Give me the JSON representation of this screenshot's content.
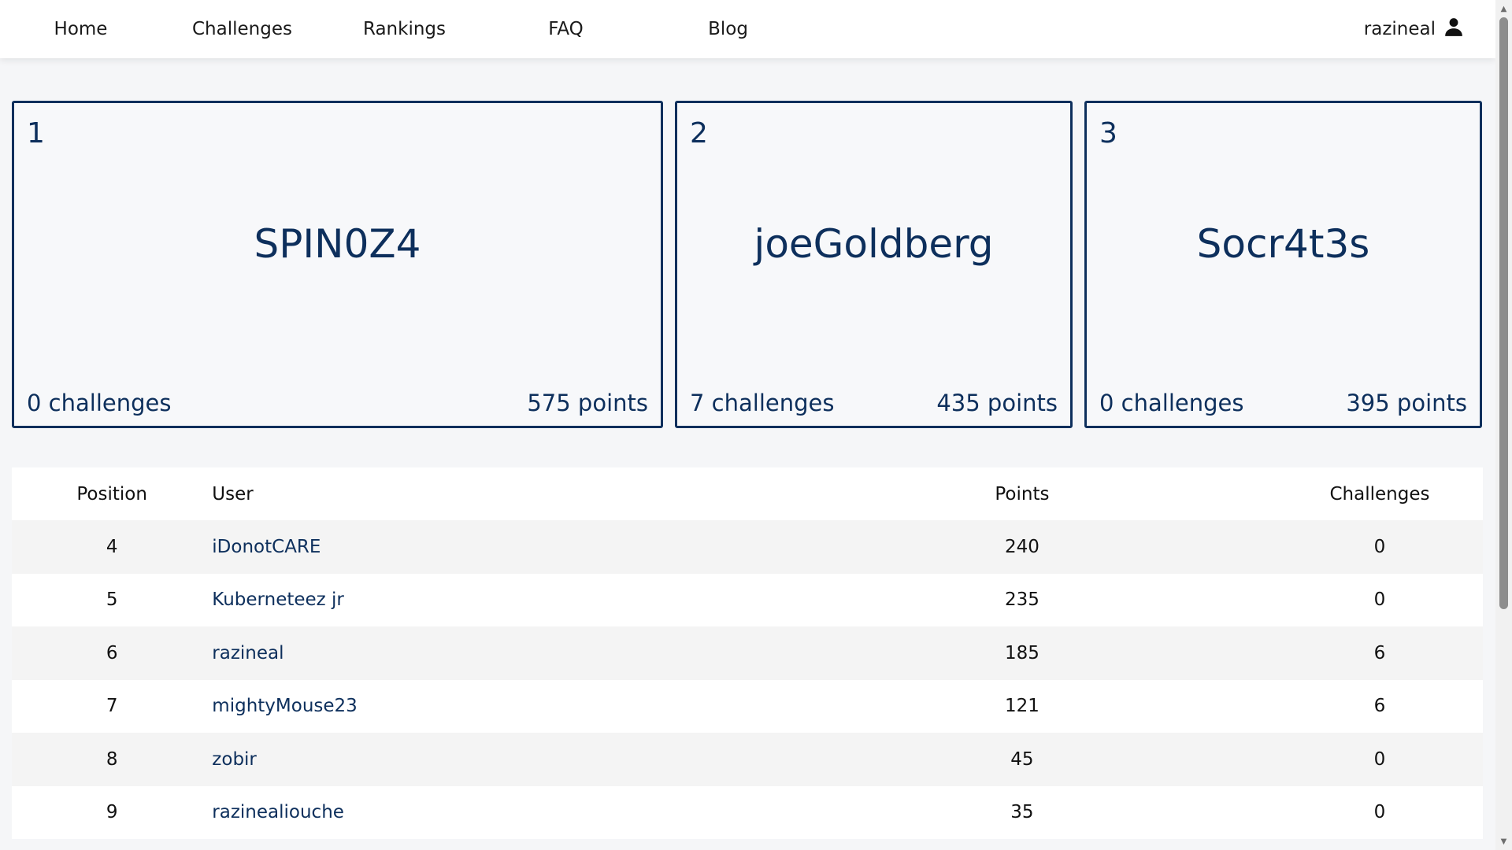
{
  "nav": {
    "items": [
      {
        "label": "Home"
      },
      {
        "label": "Challenges"
      },
      {
        "label": "Rankings"
      },
      {
        "label": "FAQ"
      },
      {
        "label": "Blog"
      }
    ],
    "username": "razineal",
    "user_icon": "user-icon"
  },
  "podium": [
    {
      "rank": "1",
      "name": "SPIN0Z4",
      "challenges": "0 challenges",
      "points": "575 points"
    },
    {
      "rank": "2",
      "name": "joeGoldberg",
      "challenges": "7 challenges",
      "points": "435 points"
    },
    {
      "rank": "3",
      "name": "Socr4t3s",
      "challenges": "0 challenges",
      "points": "395 points"
    }
  ],
  "table": {
    "headers": {
      "position": "Position",
      "user": "User",
      "points": "Points",
      "challenges": "Challenges"
    },
    "rows": [
      {
        "position": "4",
        "user": "iDonotCARE",
        "points": "240",
        "challenges": "0"
      },
      {
        "position": "5",
        "user": "Kuberneteez jr",
        "points": "235",
        "challenges": "0"
      },
      {
        "position": "6",
        "user": "razineal",
        "points": "185",
        "challenges": "6"
      },
      {
        "position": "7",
        "user": "mightyMouse23",
        "points": "121",
        "challenges": "6"
      },
      {
        "position": "8",
        "user": "zobir",
        "points": "45",
        "challenges": "0"
      },
      {
        "position": "9",
        "user": "razinealiouche",
        "points": "35",
        "challenges": "0"
      }
    ]
  },
  "colors": {
    "accent": "#0d2f5c",
    "row_alt": "#f4f4f4",
    "background": "#f5f6f8"
  }
}
